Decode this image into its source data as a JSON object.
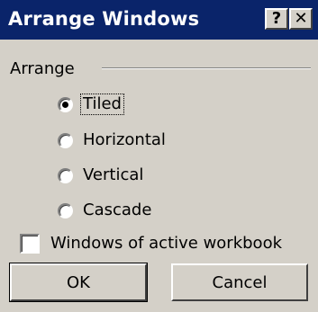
{
  "window": {
    "title": "Arrange Windows",
    "help_icon": "?",
    "close_icon": "✕"
  },
  "arrange": {
    "group_label": "Arrange",
    "options": [
      {
        "label": "Tiled",
        "checked": true
      },
      {
        "label": "Horizontal",
        "checked": false
      },
      {
        "label": "Vertical",
        "checked": false
      },
      {
        "label": "Cascade",
        "checked": false
      }
    ]
  },
  "windows_of_active_workbook": {
    "label": "Windows of active workbook",
    "checked": false
  },
  "buttons": {
    "ok_label": "OK",
    "cancel_label": "Cancel"
  },
  "colors": {
    "titlebar": "#0a246a",
    "face": "#d4d0c8"
  }
}
